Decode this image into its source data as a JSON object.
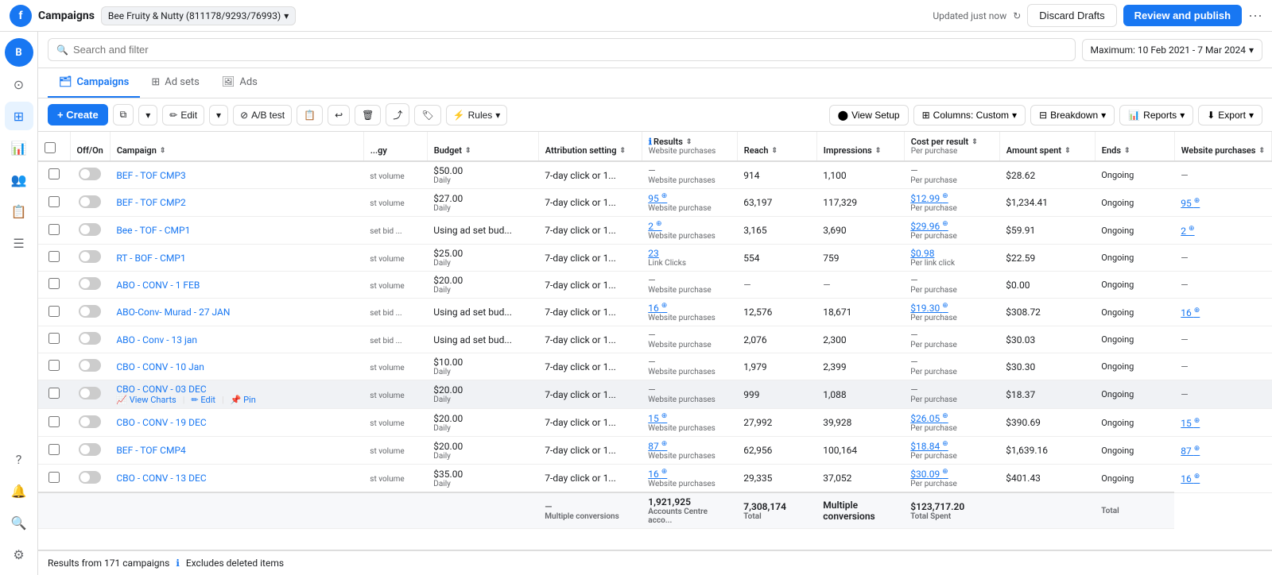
{
  "topbar": {
    "logo": "f",
    "title": "Campaigns",
    "account": "Bee Fruity & Nutty (811178/9293/76993)",
    "updated": "Updated just now",
    "btn_discard": "Discard Drafts",
    "btn_review": "Review and publish"
  },
  "search": {
    "placeholder": "Search and filter",
    "date_range": "Maximum: 10 Feb 2021 - 7 Mar 2024"
  },
  "nav": {
    "tabs": [
      {
        "id": "campaigns",
        "label": "Campaigns",
        "active": true
      },
      {
        "id": "adsets",
        "label": "Ad sets",
        "active": false
      },
      {
        "id": "ads",
        "label": "Ads",
        "active": false
      }
    ]
  },
  "toolbar": {
    "create": "+ Create",
    "edit": "Edit",
    "ab_test": "A/B test",
    "rules": "Rules",
    "view_setup": "View Setup",
    "columns_label": "Columns: Custom",
    "breakdown": "Breakdown",
    "reports": "Reports",
    "export": "Export"
  },
  "table": {
    "columns": [
      {
        "id": "off_on",
        "label": "Off/On"
      },
      {
        "id": "campaign",
        "label": "Campaign"
      },
      {
        "id": "strategy",
        "label": "...gy"
      },
      {
        "id": "budget",
        "label": "Budget"
      },
      {
        "id": "attribution",
        "label": "Attribution setting"
      },
      {
        "id": "results",
        "label": "Results",
        "sub": "Website purchases"
      },
      {
        "id": "reach",
        "label": "Reach"
      },
      {
        "id": "impressions",
        "label": "Impressions"
      },
      {
        "id": "cost_per_result",
        "label": "Cost per result",
        "sub": "Per purchase"
      },
      {
        "id": "amount_spent",
        "label": "Amount spent"
      },
      {
        "id": "ends",
        "label": "Ends"
      },
      {
        "id": "website_purchases",
        "label": "Website purchases"
      }
    ],
    "rows": [
      {
        "id": "row1",
        "on": false,
        "campaign": "BEF - TOF CMP3",
        "strategy": "st volume",
        "budget": "$50.00",
        "budget_period": "Daily",
        "attribution": "7-day click or 1...",
        "results": "—",
        "results_sub": "Website purchases",
        "reach": "914",
        "impressions": "1,100",
        "cost_per_result": "—",
        "cost_sub": "Per purchase",
        "amount_spent": "$28.62",
        "ends": "Ongoing",
        "website_purchases": "—",
        "is_hover": false
      },
      {
        "id": "row2",
        "on": false,
        "campaign": "BEF - TOF CMP2",
        "strategy": "st volume",
        "budget": "$27.00",
        "budget_period": "Daily",
        "attribution": "7-day click or 1...",
        "results": "95",
        "results_info": true,
        "results_sub": "Website purchase",
        "reach": "63,197",
        "impressions": "117,329",
        "cost_per_result": "$12.99",
        "cost_info": true,
        "cost_sub": "Per purchase",
        "amount_spent": "$1,234.41",
        "ends": "Ongoing",
        "website_purchases": "95",
        "wp_info": true
      },
      {
        "id": "row3",
        "on": false,
        "campaign": "Bee - TOF - CMP1",
        "strategy": "set bid ...",
        "budget": "Using ad set bud...",
        "budget_period": "",
        "attribution": "7-day click or 1...",
        "results": "2",
        "results_info": true,
        "results_sub": "Website purchases",
        "reach": "3,165",
        "impressions": "3,690",
        "cost_per_result": "$29.96",
        "cost_info": true,
        "cost_sub": "Per purchase",
        "amount_spent": "$59.91",
        "ends": "Ongoing",
        "website_purchases": "2",
        "wp_info": true
      },
      {
        "id": "row4",
        "on": false,
        "campaign": "RT - BOF - CMP1",
        "strategy": "st volume",
        "budget": "$25.00",
        "budget_period": "Daily",
        "attribution": "7-day click or 1...",
        "results": "23",
        "results_sub": "Link Clicks",
        "reach": "554",
        "impressions": "759",
        "cost_per_result": "$0.98",
        "cost_sub": "Per link click",
        "amount_spent": "$22.59",
        "ends": "Ongoing",
        "website_purchases": "—"
      },
      {
        "id": "row5",
        "on": false,
        "campaign": "ABO - CONV - 1 FEB",
        "strategy": "st volume",
        "budget": "$20.00",
        "budget_period": "Daily",
        "attribution": "7-day click or 1...",
        "results": "—",
        "results_sub": "Website purchase",
        "reach": "—",
        "impressions": "—",
        "cost_per_result": "—",
        "cost_sub": "Per purchase",
        "amount_spent": "$0.00",
        "ends": "Ongoing",
        "website_purchases": "—"
      },
      {
        "id": "row6",
        "on": false,
        "campaign": "ABO-Conv- Murad - 27 JAN",
        "strategy": "set bid ...",
        "budget": "Using ad set bud...",
        "budget_period": "",
        "attribution": "7-day click or 1...",
        "results": "16",
        "results_info": true,
        "results_sub": "Website purchases",
        "reach": "12,576",
        "impressions": "18,671",
        "cost_per_result": "$19.30",
        "cost_info": true,
        "cost_sub": "Per purchase",
        "amount_spent": "$308.72",
        "ends": "Ongoing",
        "website_purchases": "16",
        "wp_info": true
      },
      {
        "id": "row7",
        "on": false,
        "campaign": "ABO - Conv - 13 jan",
        "strategy": "set bid ...",
        "budget": "Using ad set bud...",
        "budget_period": "",
        "attribution": "7-day click or 1...",
        "results": "—",
        "results_sub": "Website purchase",
        "reach": "2,076",
        "impressions": "2,300",
        "cost_per_result": "—",
        "cost_sub": "Per purchase",
        "amount_spent": "$30.03",
        "ends": "Ongoing",
        "website_purchases": "—"
      },
      {
        "id": "row8",
        "on": false,
        "campaign": "CBO - CONV - 10 Jan",
        "strategy": "st volume",
        "budget": "$10.00",
        "budget_period": "Daily",
        "attribution": "7-day click or 1...",
        "results": "—",
        "results_sub": "Website purchases",
        "reach": "1,979",
        "impressions": "2,399",
        "cost_per_result": "—",
        "cost_sub": "Per purchase",
        "amount_spent": "$30.30",
        "ends": "Ongoing",
        "website_purchases": "—"
      },
      {
        "id": "row9",
        "on": false,
        "campaign": "CBO - CONV - 03 DEC",
        "strategy": "st volume",
        "budget": "$20.00",
        "budget_period": "Daily",
        "attribution": "7-day click or 1...",
        "results": "—",
        "results_sub": "Website purchases",
        "reach": "999",
        "impressions": "1,088",
        "cost_per_result": "—",
        "cost_sub": "Per purchase",
        "amount_spent": "$18.37",
        "ends": "Ongoing",
        "website_purchases": "—",
        "is_hover": true
      },
      {
        "id": "row10",
        "on": false,
        "campaign": "CBO - CONV - 19 DEC",
        "strategy": "st volume",
        "budget": "$20.00",
        "budget_period": "Daily",
        "attribution": "7-day click or 1...",
        "results": "15",
        "results_info": true,
        "results_sub": "Website purchases",
        "reach": "27,992",
        "impressions": "39,928",
        "cost_per_result": "$26.05",
        "cost_info": true,
        "cost_sub": "Per purchase",
        "amount_spent": "$390.69",
        "ends": "Ongoing",
        "website_purchases": "15",
        "wp_info": true
      },
      {
        "id": "row11",
        "on": false,
        "campaign": "BEF - TOF CMP4",
        "strategy": "st volume",
        "budget": "$20.00",
        "budget_period": "Daily",
        "attribution": "7-day click or 1...",
        "results": "87",
        "results_info": true,
        "results_sub": "Website purchases",
        "reach": "62,956",
        "impressions": "100,164",
        "cost_per_result": "$18.84",
        "cost_info": true,
        "cost_sub": "Per purchase",
        "amount_spent": "$1,639.16",
        "ends": "Ongoing",
        "website_purchases": "87",
        "wp_info": true
      },
      {
        "id": "row12",
        "on": false,
        "campaign": "CBO - CONV - 13 DEC",
        "strategy": "st volume",
        "budget": "$35.00",
        "budget_period": "Daily",
        "attribution": "7-day click or 1...",
        "results": "16",
        "results_info": true,
        "results_sub": "Website purchases",
        "reach": "29,335",
        "impressions": "37,052",
        "cost_per_result": "$30.09",
        "cost_info": true,
        "cost_sub": "Per purchase",
        "amount_spent": "$401.43",
        "ends": "Ongoing",
        "website_purchases": "16",
        "wp_info": true
      }
    ],
    "totals": {
      "results_count": "—",
      "results_sub": "Multiple conversions",
      "reach": "1,921,925",
      "reach_sub": "Accounts Centre acco...",
      "impressions": "7,308,174",
      "impressions_sub": "Total",
      "cost_per_result": "Multiple conversions",
      "amount_spent": "$123,717.20",
      "amount_sub": "Total Spent",
      "website_purchases": "Total",
      "footer_note": "Results from 171 campaigns",
      "footer_sub": "Excludes deleted items"
    }
  }
}
